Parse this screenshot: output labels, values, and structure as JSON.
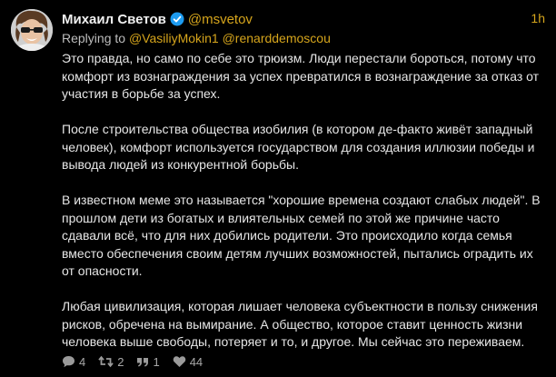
{
  "author": {
    "display_name": "Михаил Светов",
    "handle": "@msvetov",
    "verified": true,
    "time": "1h"
  },
  "reply": {
    "prefix": "Replying to",
    "mentions": [
      "@VasiliyMokin1",
      "@renarddemoscou"
    ]
  },
  "paragraphs": [
    "Это правда, но само по себе это трюизм. Люди перестали бороться, потому что комфорт из вознаграждения за успех превратился в вознаграждение за отказ от участия в борьбе за успех.",
    "После строительства общества изобилия (в котором де-факто живёт западный человек), комфорт используется государством для создания иллюзии победы и вывода людей из конкурентной борьбы.",
    "В известном меме это называется \"хорошие времена создают слабых людей\". В прошлом дети из богатых и влиятельных семей по этой же причине часто сдавали всё, что для них добились родители. Это происходило когда семья вместо обеспечения своим детям лучших возможностей, пытались оградить их от опасности.",
    "Любая цивилизация, которая лишает человека субъектности в пользу снижения рисков, обречена на вымирание. А общество, которое ставит ценность жизни человека выше свободы, потеряет и то, и другое. Мы сейчас это переживаем."
  ],
  "actions": {
    "replies": "4",
    "retweets": "2",
    "quotes": "1",
    "likes": "44"
  },
  "colors": {
    "background": "#000000",
    "accent": "#d6a51c",
    "text": "#e6e6e6",
    "muted": "#9a9a9a"
  }
}
